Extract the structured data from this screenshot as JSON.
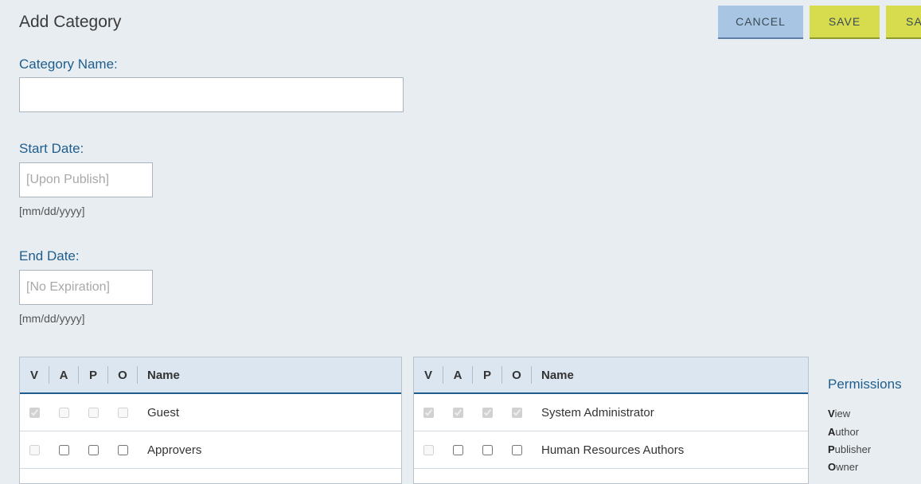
{
  "page": {
    "title": "Add Category"
  },
  "toolbar": {
    "cancel_label": "CANCEL",
    "save_label": "SAVE",
    "save_more_label": "SA"
  },
  "form": {
    "category_name": {
      "label": "Category Name:",
      "value": "",
      "placeholder": ""
    },
    "start_date": {
      "label": "Start Date:",
      "value": "",
      "placeholder": "[Upon Publish]",
      "hint": "[mm/dd/yyyy]"
    },
    "end_date": {
      "label": "End Date:",
      "value": "",
      "placeholder": "[No Expiration]",
      "hint": "[mm/dd/yyyy]"
    }
  },
  "tables": {
    "columns": [
      "V",
      "A",
      "P",
      "O",
      "Name"
    ],
    "left": {
      "rows": [
        {
          "name": "Guest",
          "perms": {
            "v": true,
            "a": false,
            "p": false,
            "o": false
          },
          "disabled": {
            "v": true,
            "a": true,
            "p": true,
            "o": true
          }
        },
        {
          "name": "Approvers",
          "perms": {
            "v": false,
            "a": false,
            "p": false,
            "o": false
          },
          "disabled": {
            "v": true,
            "a": false,
            "p": false,
            "o": false
          }
        }
      ]
    },
    "right": {
      "rows": [
        {
          "name": "System Administrator",
          "perms": {
            "v": true,
            "a": true,
            "p": true,
            "o": true
          },
          "disabled": {
            "v": true,
            "a": true,
            "p": true,
            "o": true
          }
        },
        {
          "name": "Human Resources Authors",
          "perms": {
            "v": false,
            "a": false,
            "p": false,
            "o": false
          },
          "disabled": {
            "v": true,
            "a": false,
            "p": false,
            "o": false
          }
        }
      ]
    }
  },
  "legend": {
    "title": "Permissions",
    "items": [
      {
        "letter": "V",
        "rest": "iew"
      },
      {
        "letter": "A",
        "rest": "uthor"
      },
      {
        "letter": "P",
        "rest": "ublisher"
      },
      {
        "letter": "O",
        "rest": "wner"
      }
    ]
  },
  "colors": {
    "accent": "#1f5e8c",
    "cancel_bg": "#a8c6e3",
    "save_bg": "#d6dc4e",
    "page_bg": "#e8edf2"
  }
}
